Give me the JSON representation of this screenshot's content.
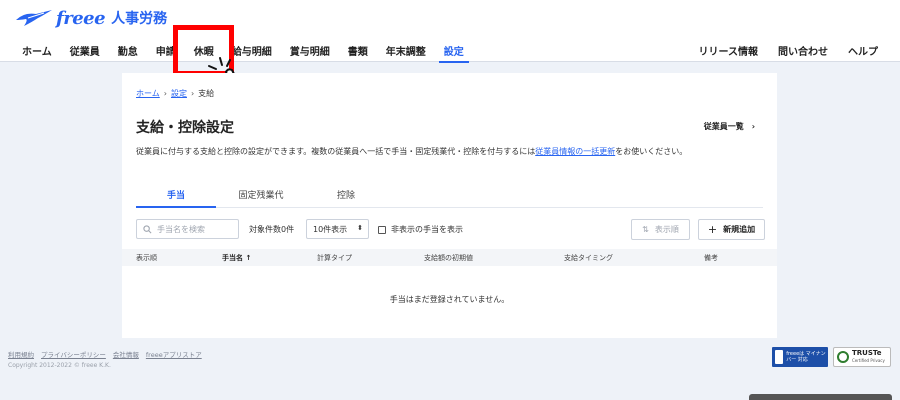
{
  "header": {
    "brand": "freee",
    "product": "人事労務",
    "nav_left": [
      "ホーム",
      "従業員",
      "勤怠",
      "申請",
      "休暇",
      "給与明細",
      "賞与明細",
      "書類",
      "年末調整",
      "設定"
    ],
    "nav_right": [
      "リリース情報",
      "問い合わせ",
      "ヘルプ"
    ],
    "active_nav": "設定",
    "highlighted_nav": "休暇"
  },
  "breadcrumb": {
    "home": "ホーム",
    "settings": "設定",
    "current": "支給"
  },
  "page": {
    "title": "支給・控除設定",
    "employee_list_link": "従業員一覧",
    "description_before": "従業員に付与する支給と控除の設定ができます。複数の従業員へ一括で手当・固定残業代・控除を付与するには",
    "description_link": "従業員情報の一括更新",
    "description_after": "をお使いください。"
  },
  "tabs": [
    "手当",
    "固定残業代",
    "控除"
  ],
  "active_tab": "手当",
  "toolbar": {
    "search_placeholder": "手当名を検索",
    "count_label": "対象件数0件",
    "page_size": "10件表示",
    "hidden_checkbox_label": "非表示の手当を表示",
    "sort_button": "表示順",
    "add_button": "新規追加"
  },
  "table": {
    "columns": [
      "表示順",
      "手当名",
      "計算タイプ",
      "支給額の初期値",
      "支給タイミング",
      "備考"
    ],
    "empty_message": "手当はまだ登録されていません。"
  },
  "footer": {
    "links": [
      "利用規約",
      "プライバシーポリシー",
      "会社情報",
      "freeeアプリストア"
    ],
    "copyright": "Copyright 2012-2022 © freee K.K.",
    "mynumber_badge": "freeeは マイナンバー 対応",
    "truste_badge": "TRUSTe",
    "truste_sub": "Certified Privacy"
  }
}
